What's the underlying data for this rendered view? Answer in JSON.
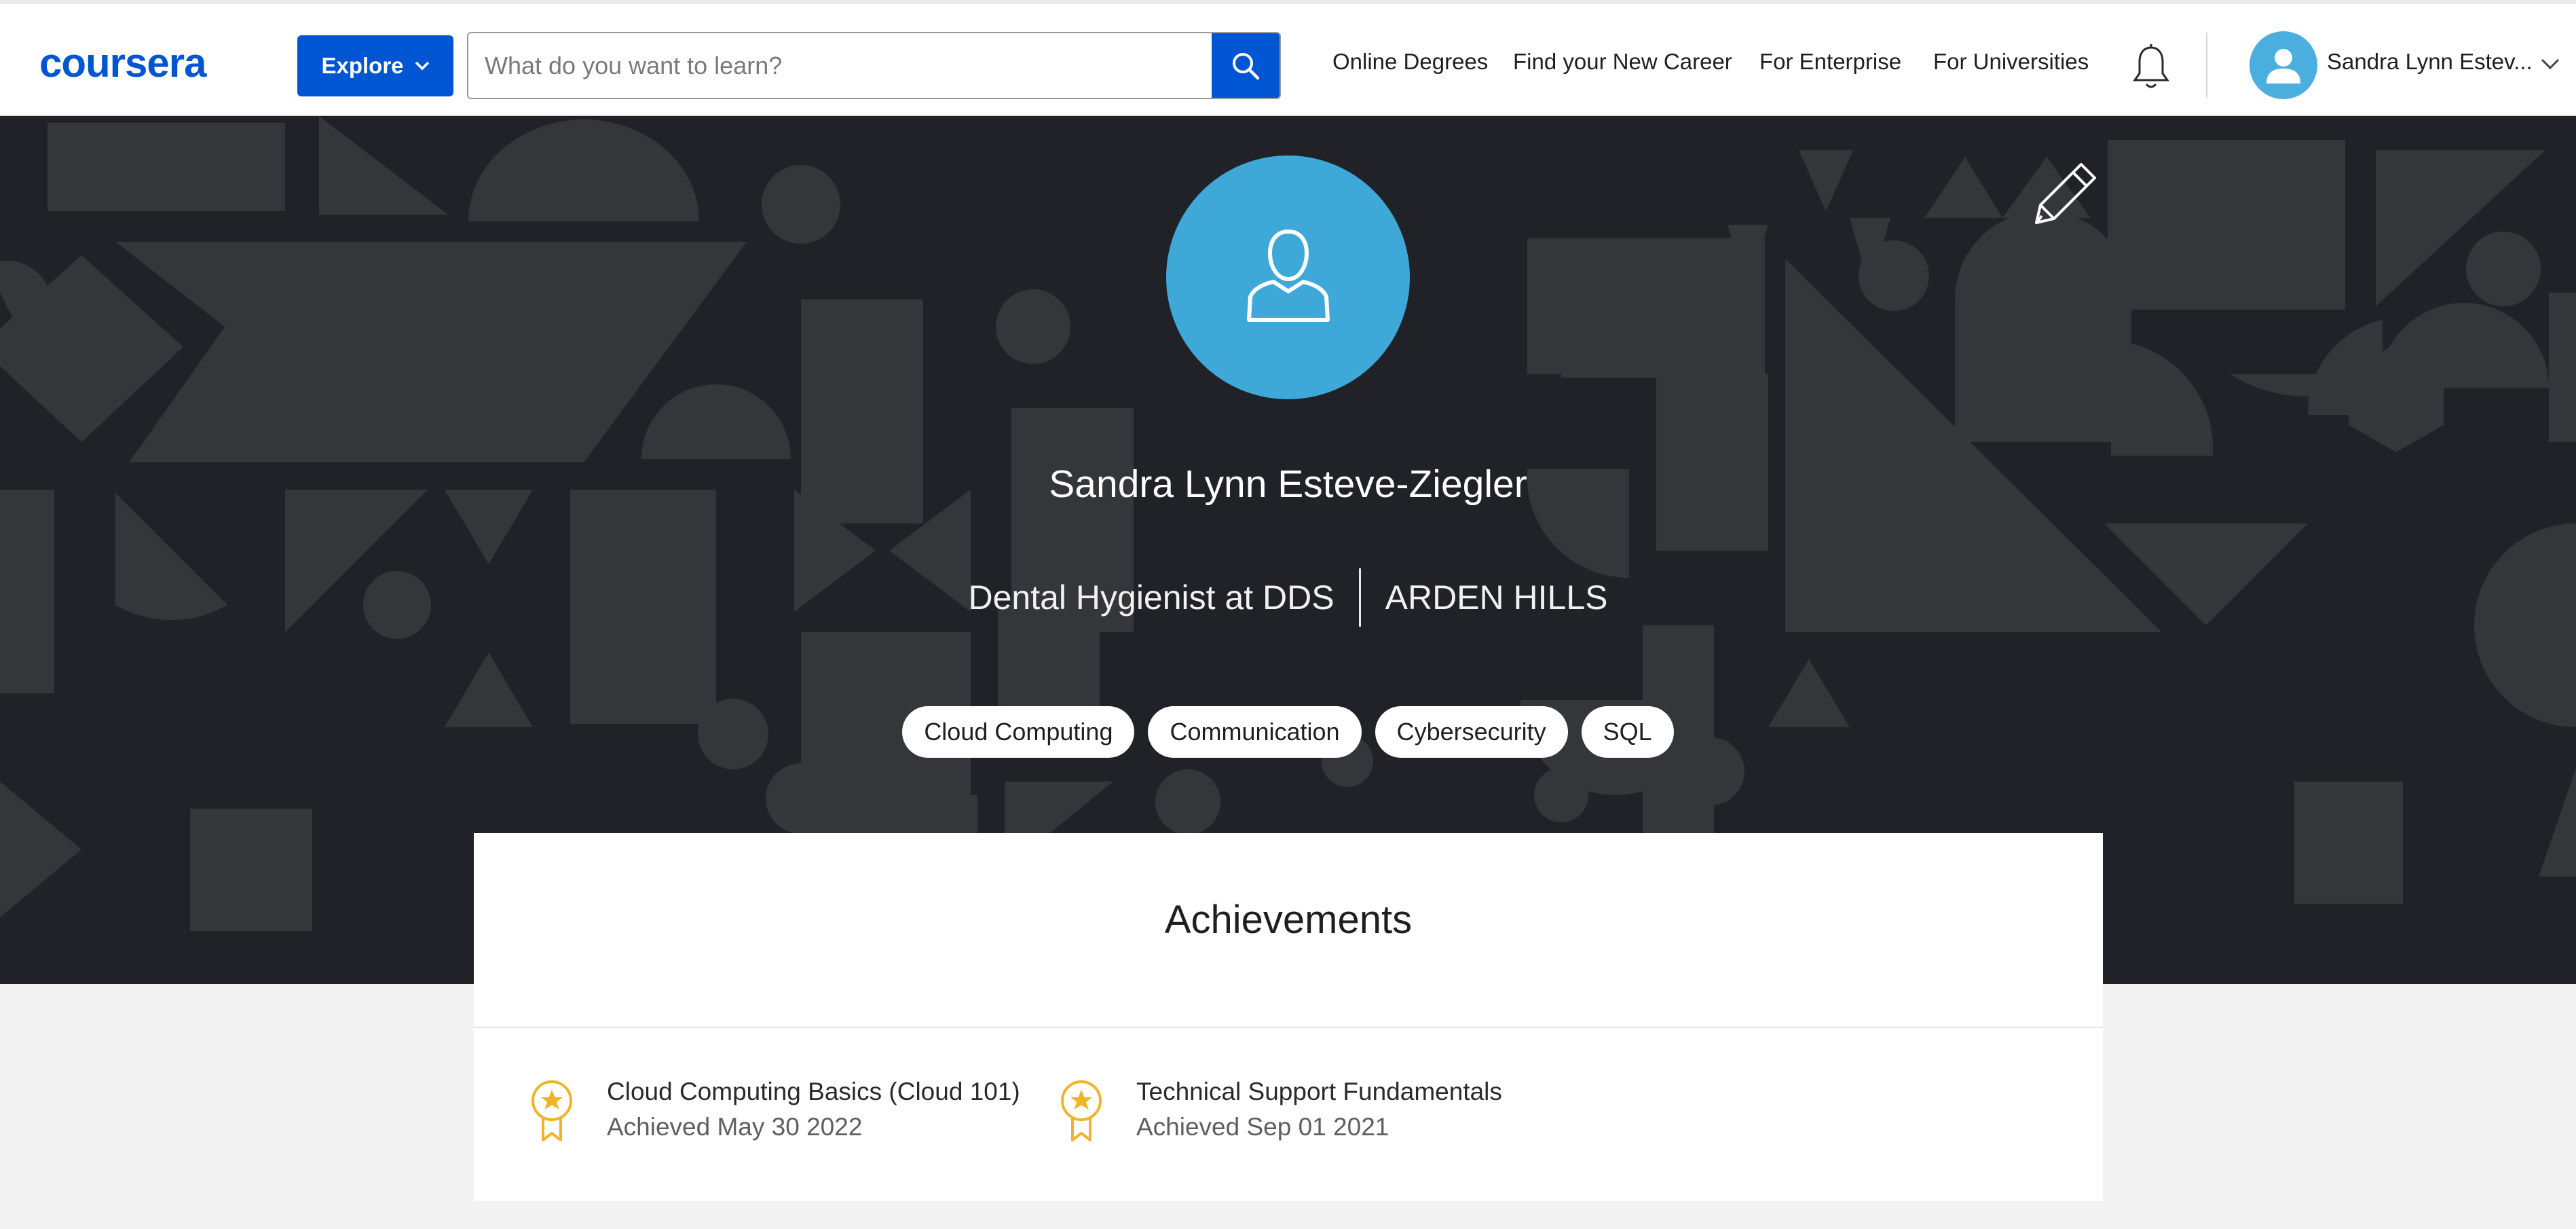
{
  "header": {
    "logo_text": "coursera",
    "explore_label": "Explore",
    "search_placeholder": "What do you want to learn?",
    "nav": [
      "Online Degrees",
      "Find your New Career",
      "For Enterprise",
      "For Universities"
    ],
    "user_name": "Sandra Lynn Estev...",
    "icons": [
      "search-icon",
      "bell-icon",
      "user-icon",
      "chevron-down-icon"
    ]
  },
  "profile": {
    "name": "Sandra Lynn Esteve-Ziegler",
    "headline": "Dental Hygienist at DDS",
    "location": "ARDEN HILLS",
    "skills": [
      "Cloud Computing",
      "Communication",
      "Cybersecurity",
      "SQL"
    ],
    "icons": [
      "user-icon",
      "pencil-icon"
    ]
  },
  "achievements": {
    "title": "Achievements",
    "items": [
      {
        "title": "Cloud Computing Basics (Cloud 101)",
        "date": "Achieved May 30 2022",
        "icon": "award-ribbon-icon"
      },
      {
        "title": "Technical Support Fundamentals",
        "date": "Achieved Sep 01 2021",
        "icon": "award-ribbon-icon"
      }
    ]
  },
  "colors": {
    "brand": "#0056d2",
    "hero_bg": "#202227",
    "avatar": "#3ea9d9",
    "award": "#f0b429"
  }
}
